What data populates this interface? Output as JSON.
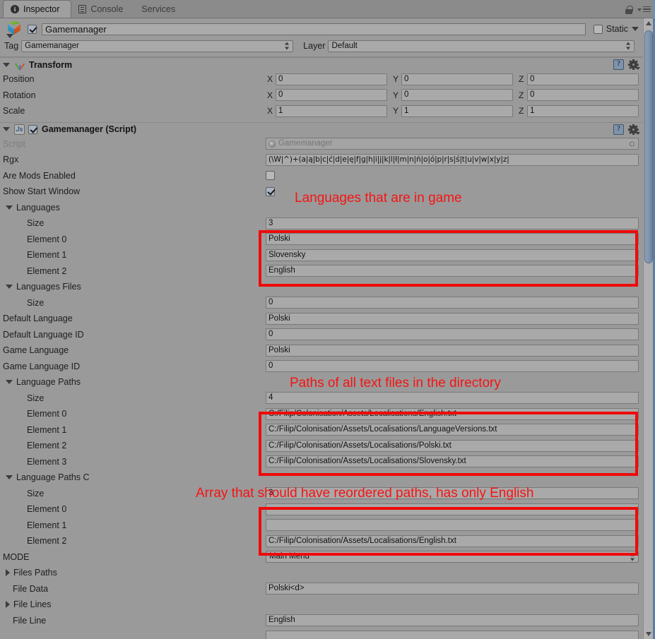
{
  "window": {
    "tabs": [
      {
        "label": "Inspector",
        "icon": "info-icon",
        "active": true
      },
      {
        "label": "Console",
        "icon": "console-icon",
        "active": false
      },
      {
        "label": "Services",
        "icon": "",
        "active": false
      }
    ],
    "lock_icon": "lock-icon",
    "menu_icon": "hamburger-menu-icon"
  },
  "gameobject": {
    "enabled": true,
    "name": "Gamemanager",
    "static_label": "Static",
    "static_checked": false,
    "tag_label": "Tag",
    "tag_value": "Gamemanager",
    "layer_label": "Layer",
    "layer_value": "Default"
  },
  "transform": {
    "title": "Transform",
    "expanded": true,
    "rows": [
      {
        "label": "Position",
        "x": "0",
        "y": "0",
        "z": "0"
      },
      {
        "label": "Rotation",
        "x": "0",
        "y": "0",
        "z": "0"
      },
      {
        "label": "Scale",
        "x": "1",
        "y": "1",
        "z": "1"
      }
    ],
    "axes": {
      "x": "X",
      "y": "Y",
      "z": "Z"
    }
  },
  "script_component": {
    "title": "Gamemanager (Script)",
    "enabled": true,
    "expanded": true,
    "script_label": "Script",
    "script_value": "Gamemanager",
    "rgx_label": "Rgx",
    "rgx_value": "(\\W|^)+(a|ą|b|c|ć|d|e|ę|f|g|h|i|j|k|l|ł|m|n|ń|o|ó|p|r|s|ś|t|u|v|w|x|y|z|",
    "are_mods_enabled_label": "Are Mods Enabled",
    "are_mods_enabled": false,
    "show_start_window_label": "Show Start Window",
    "show_start_window": true,
    "languages": {
      "label": "Languages",
      "size_label": "Size",
      "size": "3",
      "element_labels": [
        "Element 0",
        "Element 1",
        "Element 2"
      ],
      "elements": [
        "Polski",
        "Slovensky",
        "English"
      ]
    },
    "languages_files": {
      "label": "Languages Files",
      "size_label": "Size",
      "size": "0"
    },
    "default_language_label": "Default Language",
    "default_language": "Polski",
    "default_language_id_label": "Default Language ID",
    "default_language_id": "0",
    "game_language_label": "Game Language",
    "game_language": "Polski",
    "game_language_id_label": "Game Language ID",
    "game_language_id": "0",
    "language_paths": {
      "label": "Language Paths",
      "size_label": "Size",
      "size": "4",
      "element_labels": [
        "Element 0",
        "Element 1",
        "Element 2",
        "Element 3"
      ],
      "elements": [
        "C:/Filip/Colonisation/Assets/Localisations/English.txt",
        "C:/Filip/Colonisation/Assets/Localisations/LanguageVersions.txt",
        "C:/Filip/Colonisation/Assets/Localisations/Polski.txt",
        "C:/Filip/Colonisation/Assets/Localisations/Slovensky.txt"
      ]
    },
    "language_paths_c": {
      "label": "Language Paths C",
      "size_label": "Size",
      "size": "3",
      "element_labels": [
        "Element 0",
        "Element 1",
        "Element 2"
      ],
      "elements": [
        "",
        "",
        "C:/Filip/Colonisation/Assets/Localisations/English.txt"
      ]
    },
    "mode_label": "MODE",
    "mode_value": "Main Menu",
    "files_paths_label": "Files Paths",
    "file_data_label": "File Data",
    "file_data_value": "Polski<d>",
    "file_lines_label": "File Lines",
    "file_line_label": "File Line",
    "file_line_value": "English"
  },
  "annotations": [
    {
      "text": "Languages that are in game"
    },
    {
      "text": "Paths of all text files in the directory"
    },
    {
      "text": "Array that should have reordered paths, has only English"
    }
  ],
  "colors": {
    "panel_bg": "#9a9a9a",
    "field_bg": "#a9a9a9",
    "annotation_red": "#f51414",
    "scroll_thumb": "#7e92ad"
  }
}
